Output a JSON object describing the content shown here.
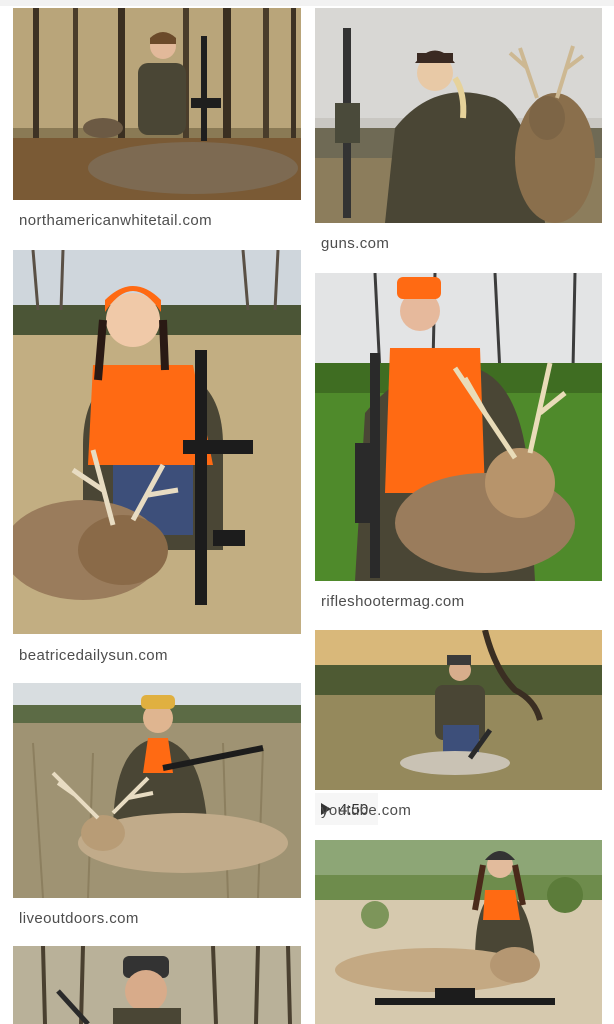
{
  "results": [
    {
      "source": "northamericanwhitetail.com"
    },
    {
      "source": "guns.com"
    },
    {
      "source": "beatricedailysun.com"
    },
    {
      "source": "rifleshootermag.com"
    },
    {
      "source": "youtube.com",
      "duration": "4:50"
    },
    {
      "source": "liveoutdoors.com"
    }
  ],
  "colors": {
    "hunter_orange": "#ff6a13",
    "camo_dark": "#4a4635",
    "grass_green": "#5a8a2a",
    "source_text": "#4d4d4d"
  }
}
